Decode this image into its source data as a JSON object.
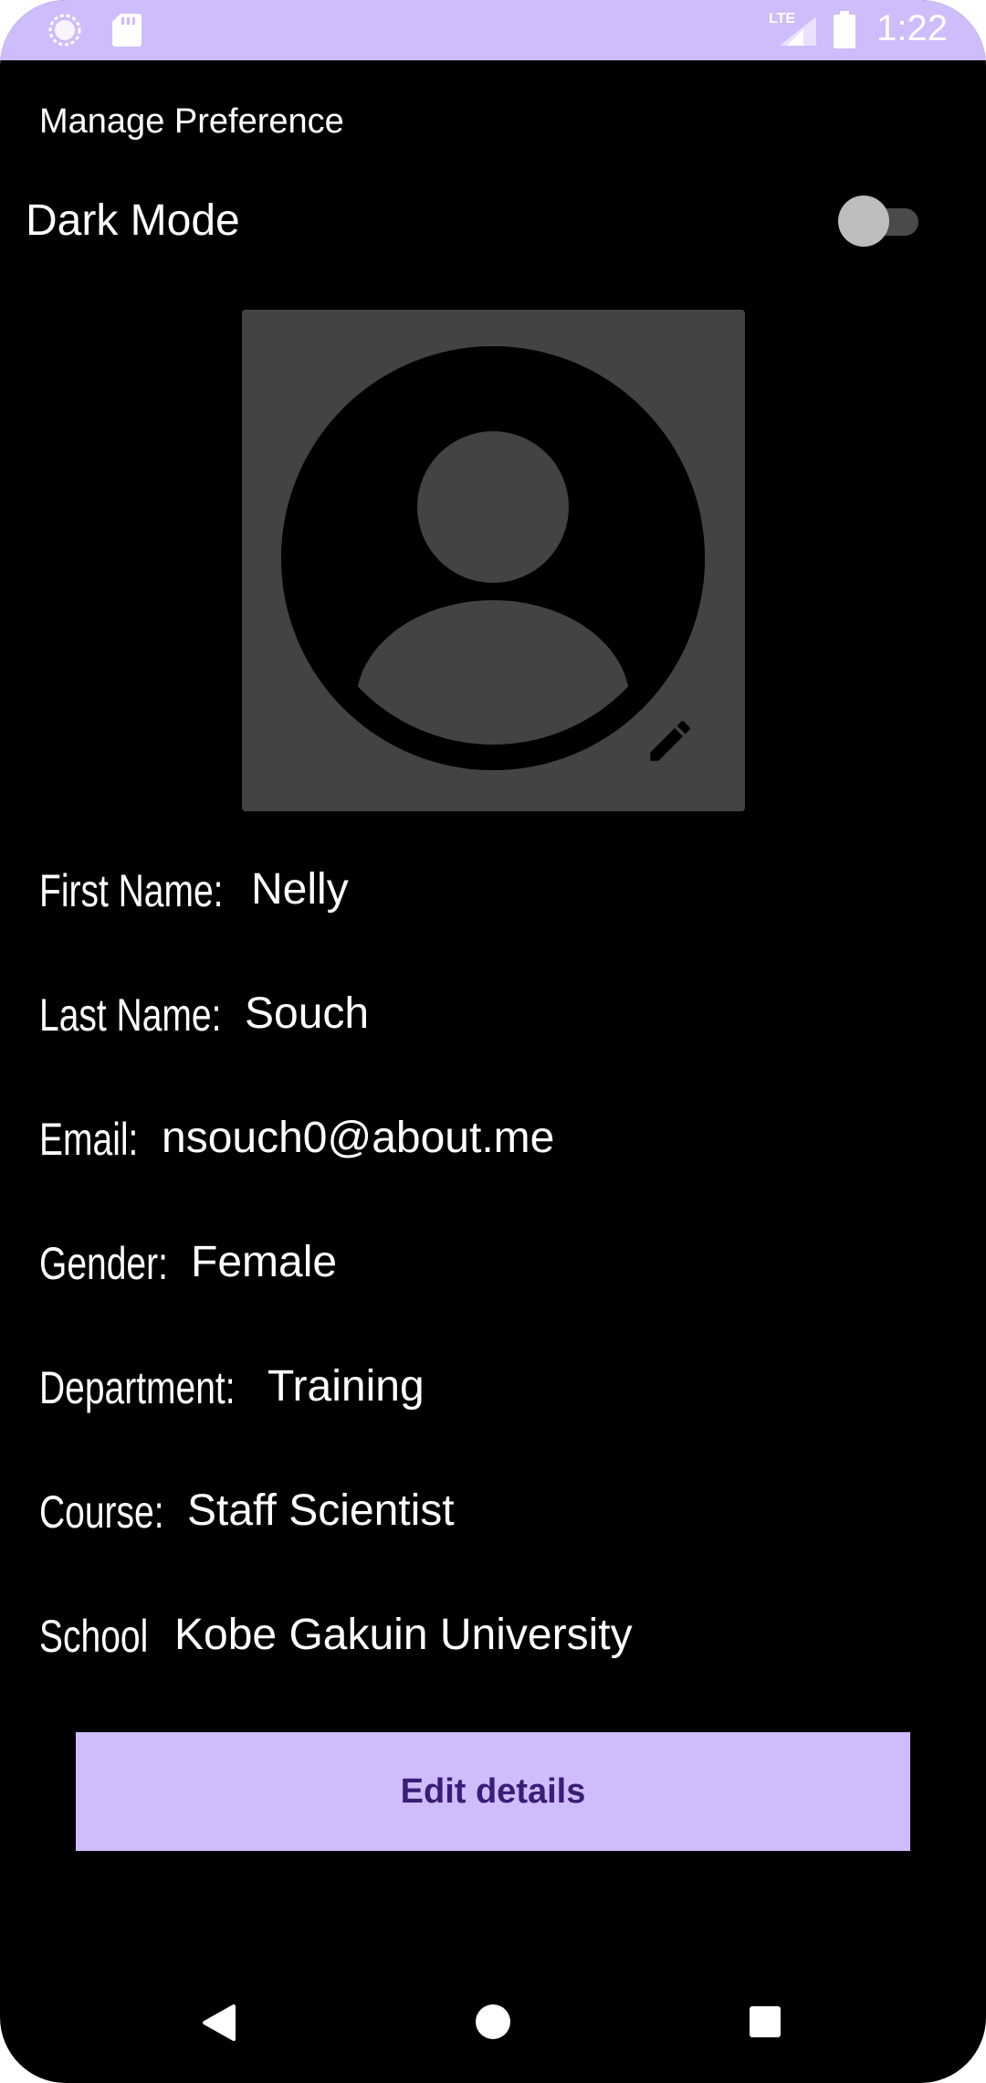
{
  "status_bar": {
    "time": "1:22",
    "network": "LTE",
    "icons": [
      "sync-icon",
      "sd-card-icon",
      "signal-icon",
      "battery-icon"
    ],
    "background": "#cfbcfa"
  },
  "header": {
    "title": "Manage Preference"
  },
  "settings": {
    "dark_mode_label": "Dark Mode",
    "dark_mode_enabled": false
  },
  "profile": {
    "avatar_icon": "account-circle-icon",
    "edit_icon": "pencil-icon",
    "fields": {
      "first_name": {
        "label": "First Name:",
        "value": "Nelly"
      },
      "last_name": {
        "label": "Last Name:",
        "value": "Souch"
      },
      "email": {
        "label": "Email:",
        "value": "nsouch0@about.me"
      },
      "gender": {
        "label": "Gender:",
        "value": "Female"
      },
      "department": {
        "label": "Department:",
        "value": "Training"
      },
      "course": {
        "label": "Course:",
        "value": "Staff Scientist"
      },
      "school": {
        "label": "School",
        "value": "Kobe Gakuin University"
      }
    }
  },
  "actions": {
    "edit_details_label": "Edit details"
  },
  "colors": {
    "accent": "#cfbcfa",
    "button_text": "#3b1d78",
    "background": "#000000",
    "avatar_background": "#434343"
  },
  "nav_bar": {
    "icons": [
      "back-icon",
      "home-icon",
      "recents-icon"
    ]
  }
}
